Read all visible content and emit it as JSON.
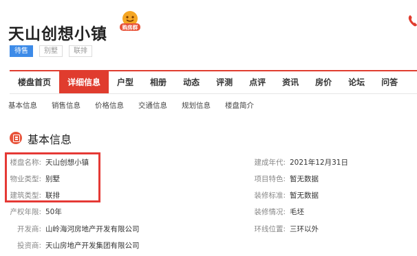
{
  "title": "天山创想小镇",
  "badge_text": "购房群",
  "tags": [
    "待售",
    "别墅",
    "联排"
  ],
  "nav": [
    "楼盘首页",
    "详细信息",
    "户型",
    "相册",
    "动态",
    "评测",
    "点评",
    "资讯",
    "房价",
    "论坛",
    "问答"
  ],
  "subnav": [
    "基本信息",
    "销售信息",
    "价格信息",
    "交通信息",
    "规划信息",
    "楼盘简介"
  ],
  "section_title": "基本信息",
  "left_fields": [
    {
      "label": "楼盘名称:",
      "value": "天山创想小镇"
    },
    {
      "label": "物业类型:",
      "value": "别墅"
    },
    {
      "label": "建筑类型:",
      "value": "联排"
    },
    {
      "label": "产权年限:",
      "value": "50年"
    },
    {
      "label": "开发商:",
      "value": "山岭海河房地产开发有限公司"
    },
    {
      "label": "投资商:",
      "value": "天山房地产开发集团有限公司"
    }
  ],
  "right_fields": [
    {
      "label": "建成年代:",
      "value": "2021年12月31日"
    },
    {
      "label": "项目特色:",
      "value": "暂无数据"
    },
    {
      "label": "装修标准:",
      "value": "暂无数据"
    },
    {
      "label": "装修情况:",
      "value": "毛坯"
    },
    {
      "label": "环线位置:",
      "value": "三环以外"
    }
  ],
  "colors": {
    "accent": "#e03c2e",
    "tag_active": "#3d8be8",
    "highlight": "#e53935",
    "badge": "#f5a623"
  }
}
